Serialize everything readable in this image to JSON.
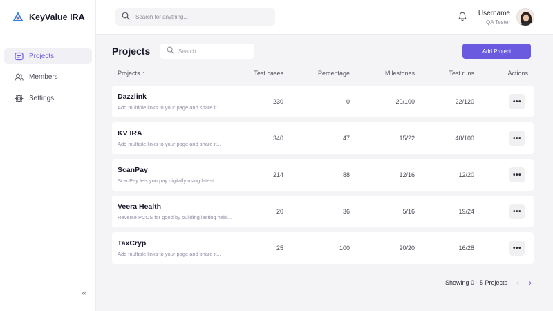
{
  "brand": {
    "name": "KeyValue IRA",
    "accent": "#6a5ae0"
  },
  "sidebar": {
    "items": [
      {
        "label": "Projects",
        "icon": "projects-icon",
        "active": true
      },
      {
        "label": "Members",
        "icon": "members-icon",
        "active": false
      },
      {
        "label": "Settings",
        "icon": "gear-icon",
        "active": false
      }
    ],
    "collapse_icon": "double-chevron-left-icon"
  },
  "topbar": {
    "search_placeholder": "Search for anything...",
    "user": {
      "name": "Username",
      "role": "QA Tester"
    }
  },
  "main": {
    "title": "Projects",
    "search_placeholder": "Search",
    "add_button": "Add Project",
    "columns": [
      "Projects",
      "Test cases",
      "Percentage",
      "Milestones",
      "Test runs",
      "Actions"
    ],
    "rows": [
      {
        "name": "Dazzlink",
        "desc": "Add multiple links to your page and share it...",
        "test_cases": "230",
        "percentage": "0",
        "milestones": "20/100",
        "test_runs": "22/120"
      },
      {
        "name": "KV IRA",
        "desc": "Add multiple links to your page and share it...",
        "test_cases": "340",
        "percentage": "47",
        "milestones": "15/22",
        "test_runs": "40/100"
      },
      {
        "name": "ScanPay",
        "desc": "ScanPay lets you pay digitally using latest...",
        "test_cases": "214",
        "percentage": "88",
        "milestones": "12/16",
        "test_runs": "12/20"
      },
      {
        "name": "Veera Health",
        "desc": "Reverse PCOS for good by building lasting habi...",
        "test_cases": "20",
        "percentage": "36",
        "milestones": "5/16",
        "test_runs": "19/24"
      },
      {
        "name": "TaxCryp",
        "desc": "Add multiple links to your page and share it...",
        "test_cases": "25",
        "percentage": "100",
        "milestones": "20/20",
        "test_runs": "16/28"
      }
    ],
    "actions_label": "•••",
    "pagination": {
      "text": "Showing 0 - 5 Projects",
      "prev": "‹",
      "next": "›"
    }
  }
}
